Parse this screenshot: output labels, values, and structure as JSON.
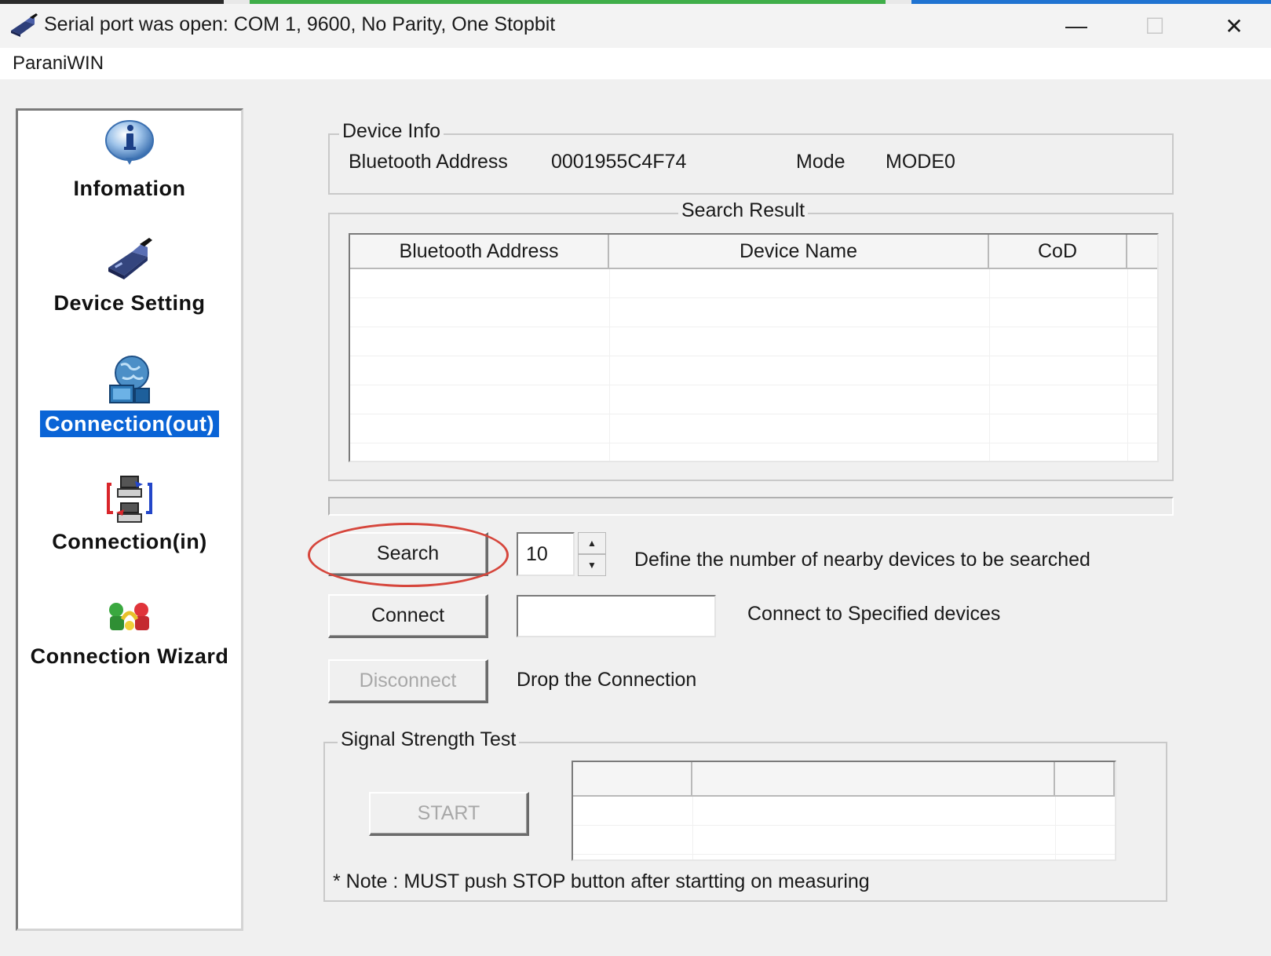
{
  "window": {
    "title": "Serial port was open: COM 1, 9600, No Parity, One Stopbit",
    "controls": {
      "minimize": "—",
      "maximize": "☐",
      "close": "✕"
    }
  },
  "menu": {
    "items": [
      "ParaniWIN"
    ]
  },
  "nav": {
    "items": [
      {
        "label": "Infomation",
        "icon": "info-icon",
        "selected": false
      },
      {
        "label": "Device Setting",
        "icon": "device-setting-icon",
        "selected": false
      },
      {
        "label": "Connection(out)",
        "icon": "connection-out-icon",
        "selected": true
      },
      {
        "label": "Connection(in)",
        "icon": "connection-in-icon",
        "selected": false
      },
      {
        "label": "Connection Wizard",
        "icon": "connection-wizard-icon",
        "selected": false
      }
    ],
    "selected_color": "#0a64d6"
  },
  "device_info": {
    "title": "Device Info",
    "address_label": "Bluetooth Address",
    "address_value": "0001955C4F74",
    "mode_label": "Mode",
    "mode_value": "MODE0"
  },
  "search_result": {
    "title": "Search Result",
    "columns": [
      "Bluetooth Address",
      "Device Name",
      "CoD"
    ],
    "rows": []
  },
  "actions": {
    "search_label": "Search",
    "search_count": "10",
    "search_desc": "Define the number of nearby devices to be searched",
    "connect_label": "Connect",
    "connect_value": "",
    "connect_desc": "Connect to Specified devices",
    "disconnect_label": "Disconnect",
    "disconnect_desc": "Drop the Connection"
  },
  "signal_test": {
    "title": "Signal Strength Test",
    "start_label": "START",
    "note": "* Note : MUST push STOP button after startting on measuring"
  },
  "annotation_color": "#d6463c"
}
